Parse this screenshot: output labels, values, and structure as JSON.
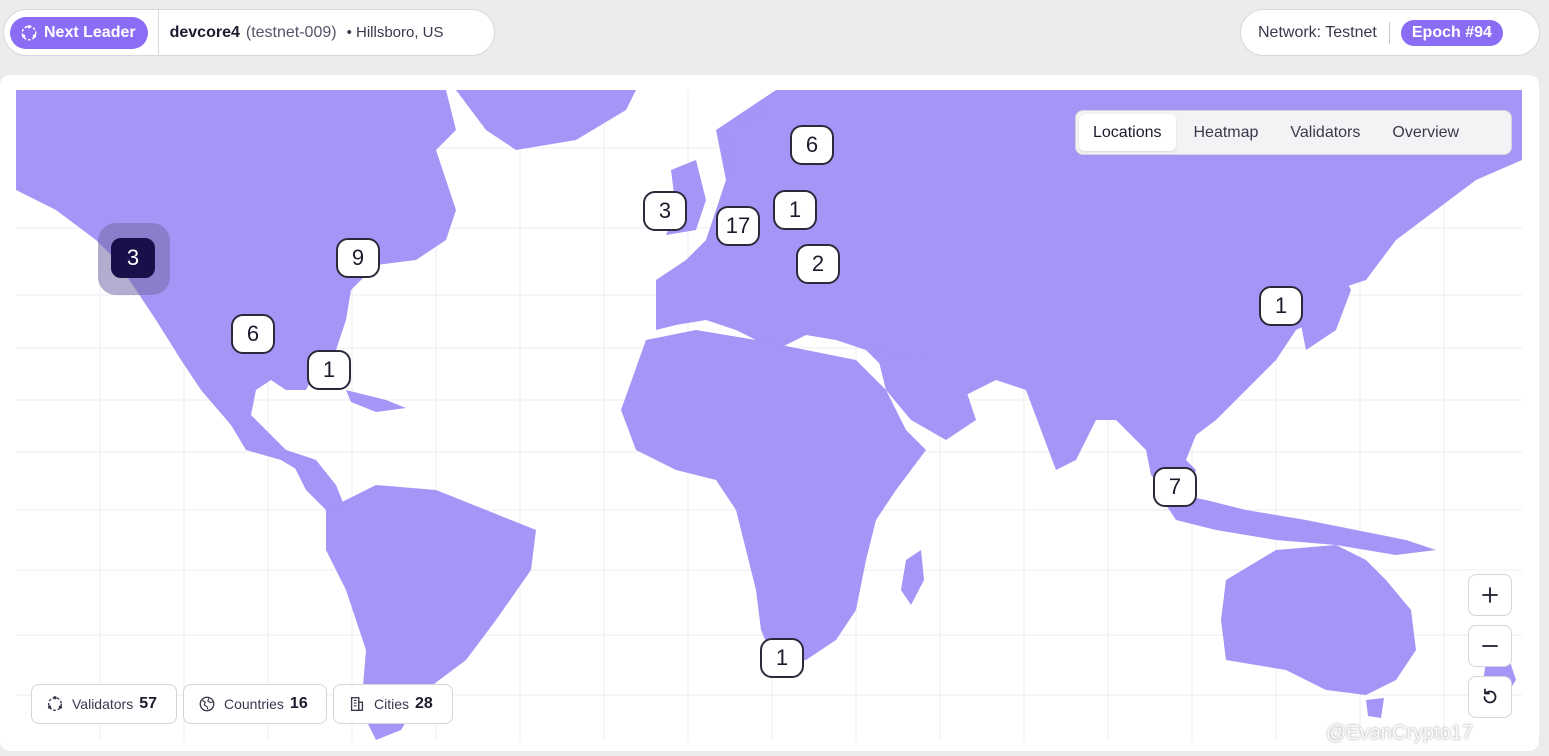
{
  "header": {
    "leader_label": "Next Leader",
    "leader_name": "devcore4",
    "leader_id": "(testnet-009)",
    "leader_location": "• Hillsboro, US",
    "network_label": "Network: Testnet",
    "epoch_label": "Epoch #94"
  },
  "tabs": [
    {
      "label": "Locations",
      "active": true
    },
    {
      "label": "Heatmap",
      "active": false
    },
    {
      "label": "Validators",
      "active": false
    },
    {
      "label": "Overview",
      "active": false
    }
  ],
  "markers": {
    "hillsboro": "3",
    "north_east_us": "9",
    "south_central_us": "6",
    "florida": "1",
    "uk": "3",
    "west_europe": "17",
    "central_europe": "1",
    "finland": "6",
    "balkans": "2",
    "japan": "1",
    "singapore": "7",
    "south_africa": "1"
  },
  "stats": {
    "validators_label": "Validators",
    "validators_value": "57",
    "countries_label": "Countries",
    "countries_value": "16",
    "cities_label": "Cities",
    "cities_value": "28"
  },
  "watermark": "@EvanCrypto17",
  "colors": {
    "accent": "#8b6cf4",
    "land": "#a495f7",
    "selected_marker": "#1b0f4a"
  }
}
